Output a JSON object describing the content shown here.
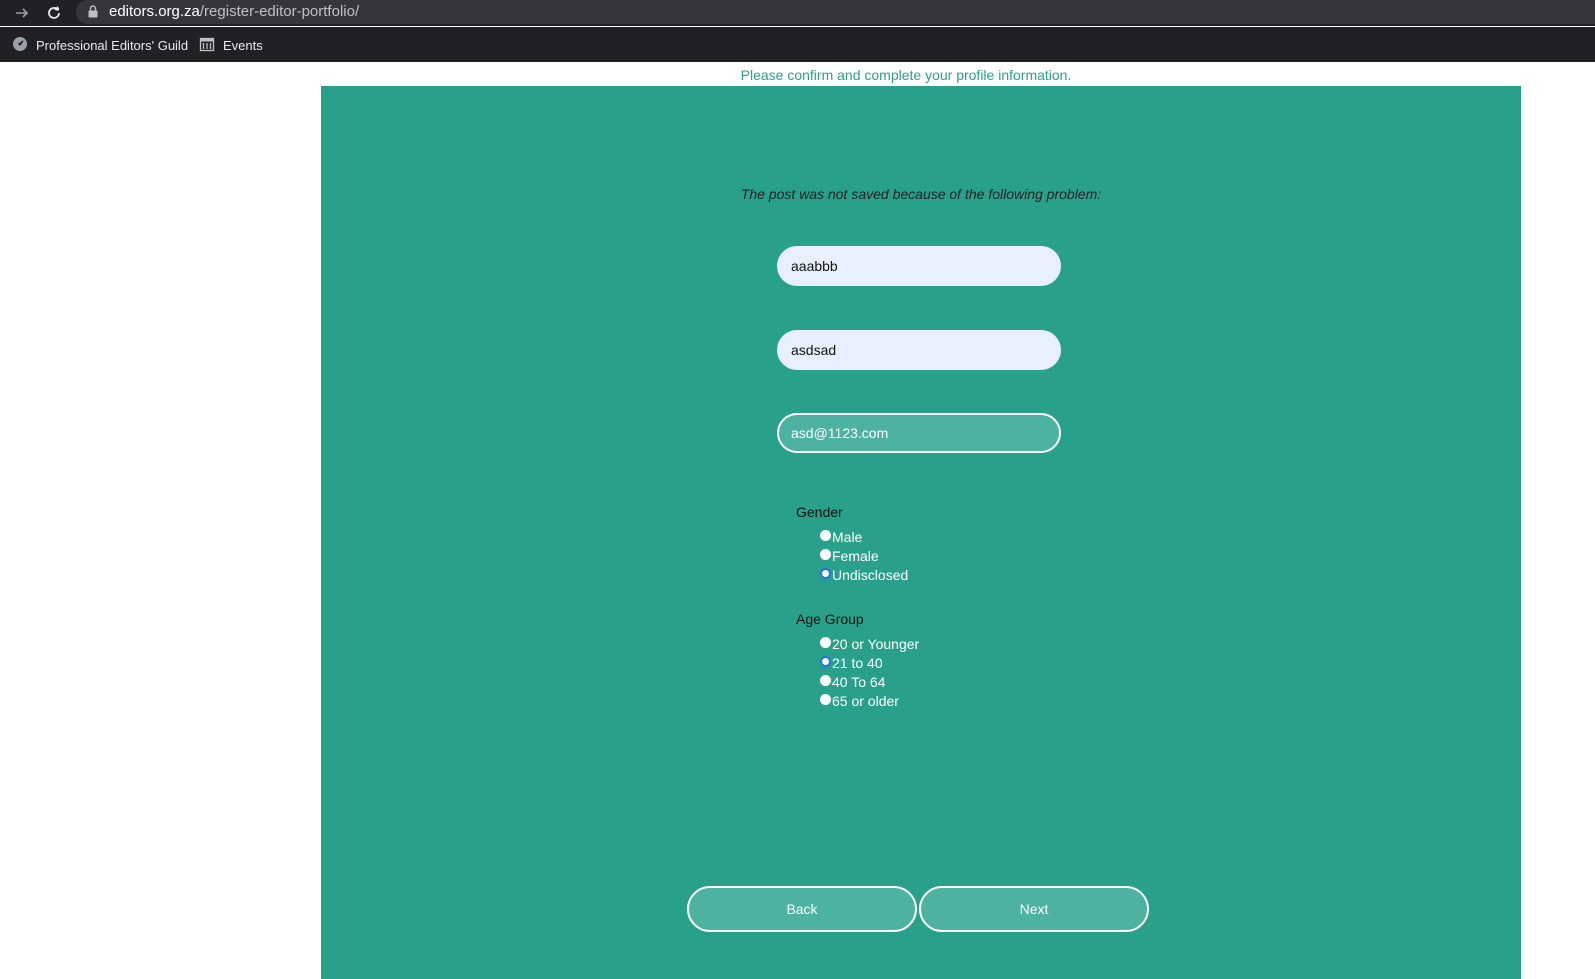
{
  "browser": {
    "url_host": "editors.org.za",
    "url_path": "/register-editor-portfolio/",
    "bookmarks": [
      {
        "label": "Professional Editors' Guild",
        "icon": "gauge-icon"
      },
      {
        "label": "Events",
        "icon": "calendar-icon"
      }
    ]
  },
  "page": {
    "subtitle": "Please confirm and complete your profile information.",
    "error_message": "The post was not saved because of the following problem:",
    "fields": {
      "first_name": "aaabbb",
      "last_name": "asdsad",
      "email": "asd@1123.com"
    },
    "gender": {
      "label": "Gender",
      "options": [
        "Male",
        "Female",
        "Undisclosed"
      ],
      "selected": "Undisclosed"
    },
    "age_group": {
      "label": "Age Group",
      "options": [
        "20 or Younger",
        "21 to 40",
        "40 To 64",
        "65 or older"
      ],
      "selected": "21 to 40"
    },
    "buttons": {
      "back": "Back",
      "next": "Next"
    }
  },
  "colors": {
    "panel": "#29a08a",
    "accent_text": "#2ba18a",
    "input_fill": "#e8f0fe",
    "button_fill": "#4db29f"
  }
}
